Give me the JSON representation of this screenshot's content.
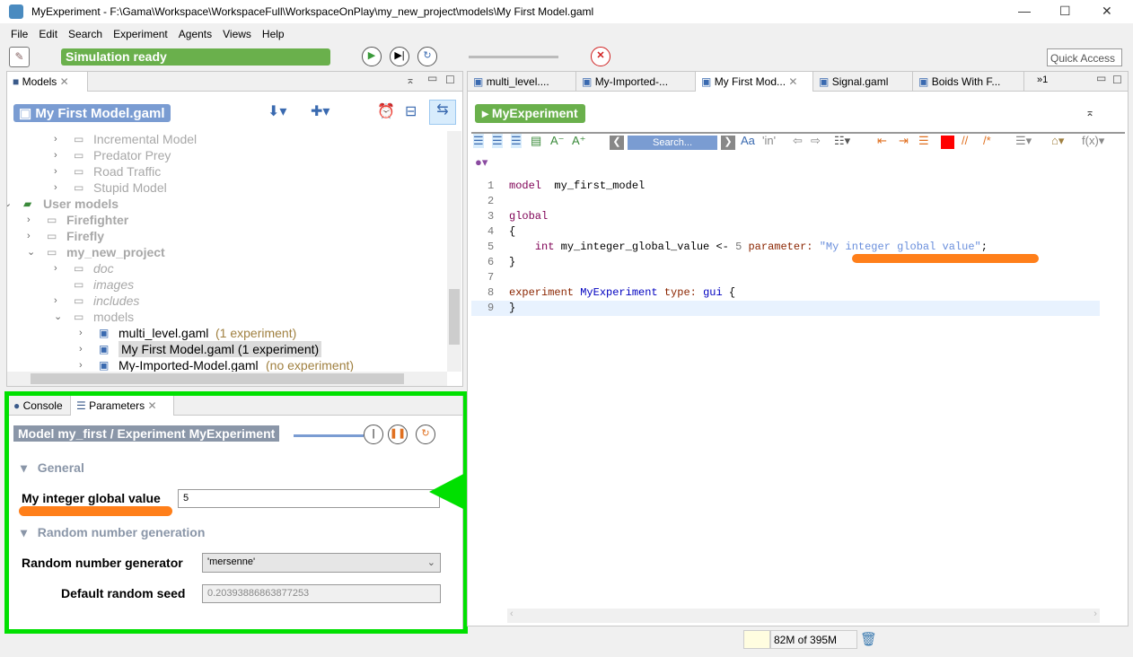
{
  "window": {
    "title": "MyExperiment - F:\\Gama\\Workspace\\WorkspaceFull\\WorkspaceOnPlay\\my_new_project\\models\\My First Model.gaml",
    "minimize": "—",
    "maximize": "☐",
    "close": "✕"
  },
  "menu": [
    "File",
    "Edit",
    "Search",
    "Experiment",
    "Agents",
    "Views",
    "Help"
  ],
  "toolbar": {
    "status": "Simulation ready",
    "quick_access": "Quick Access"
  },
  "models_panel": {
    "tab": "Models",
    "current_model": "My First Model.gaml",
    "tree": [
      {
        "label": "Incremental Model",
        "style": "lib",
        "indent": 2
      },
      {
        "label": "Predator Prey",
        "style": "lib",
        "indent": 2
      },
      {
        "label": "Road Traffic",
        "style": "lib",
        "indent": 2
      },
      {
        "label": "Stupid Model",
        "style": "lib",
        "indent": 2
      },
      {
        "label": "User models",
        "style": "root",
        "indent": 0
      },
      {
        "label": "Firefighter",
        "style": "proj",
        "indent": 1
      },
      {
        "label": "Firefly",
        "style": "proj",
        "indent": 1
      },
      {
        "label": "my_new_project",
        "style": "proj",
        "indent": 1
      },
      {
        "label": "doc",
        "style": "folder",
        "indent": 2
      },
      {
        "label": "images",
        "style": "folder",
        "indent": 2
      },
      {
        "label": "includes",
        "style": "folder",
        "indent": 2
      },
      {
        "label": "models",
        "style": "lib",
        "indent": 2
      },
      {
        "label": "multi_level.gaml",
        "note": "(1 experiment)",
        "style": "file",
        "indent": 3
      },
      {
        "label": "My First Model.gaml (1 experiment)",
        "note": "",
        "style": "file-selected",
        "indent": 3
      },
      {
        "label": "My-Imported-Model.gaml",
        "note": "(no experiment)",
        "style": "file",
        "indent": 3
      }
    ]
  },
  "params_panel": {
    "tabs": [
      "Console",
      "Parameters"
    ],
    "header": "Model my_first / Experiment MyExperiment",
    "section_general": "General",
    "param_label": "My integer global value",
    "param_value": "5",
    "section_random": "Random number generation",
    "rng_label": "Random number generator",
    "rng_value": "'mersenne'",
    "seed_label": "Default random seed",
    "seed_value": "0.20393886863877253"
  },
  "editor": {
    "tabs": [
      "multi_level....",
      "My-Imported-...",
      "My First Mod...",
      "Signal.gaml",
      "Boids With F..."
    ],
    "overflow": "»1",
    "experiment_button": "MyExperiment",
    "search_placeholder": "Search...",
    "lines": [
      {
        "n": "1",
        "parts": [
          [
            "kw",
            "model"
          ],
          [
            "",
            "  my_first_model"
          ]
        ]
      },
      {
        "n": "2",
        "parts": []
      },
      {
        "n": "3",
        "parts": [
          [
            "kw",
            "global"
          ]
        ]
      },
      {
        "n": "4",
        "parts": [
          [
            "",
            "{"
          ]
        ]
      },
      {
        "n": "5",
        "parts": [
          [
            "",
            "    "
          ],
          [
            "kw",
            "int"
          ],
          [
            "",
            " my_integer_global_value <- "
          ],
          [
            "num",
            "5"
          ],
          [
            "",
            " "
          ],
          [
            "br",
            "parameter:"
          ],
          [
            "",
            " "
          ],
          [
            "str",
            "\"My integer global value\""
          ],
          [
            "",
            ";"
          ]
        ]
      },
      {
        "n": "6",
        "parts": [
          [
            "",
            "}"
          ]
        ]
      },
      {
        "n": "7",
        "parts": []
      },
      {
        "n": "8",
        "parts": [
          [
            "br",
            "experiment"
          ],
          [
            "",
            " "
          ],
          [
            "bl",
            "MyExperiment"
          ],
          [
            "",
            " "
          ],
          [
            "br",
            "type:"
          ],
          [
            "",
            " "
          ],
          [
            "bl",
            "gui"
          ],
          [
            "",
            " {"
          ]
        ]
      },
      {
        "n": "9",
        "parts": [
          [
            "",
            "}"
          ]
        ]
      }
    ]
  },
  "statusbar": {
    "memory": "82M of 395M"
  },
  "colors": {
    "highlight": "#00e000",
    "underline": "#ff7f1a",
    "status_green": "#6ab04c"
  }
}
